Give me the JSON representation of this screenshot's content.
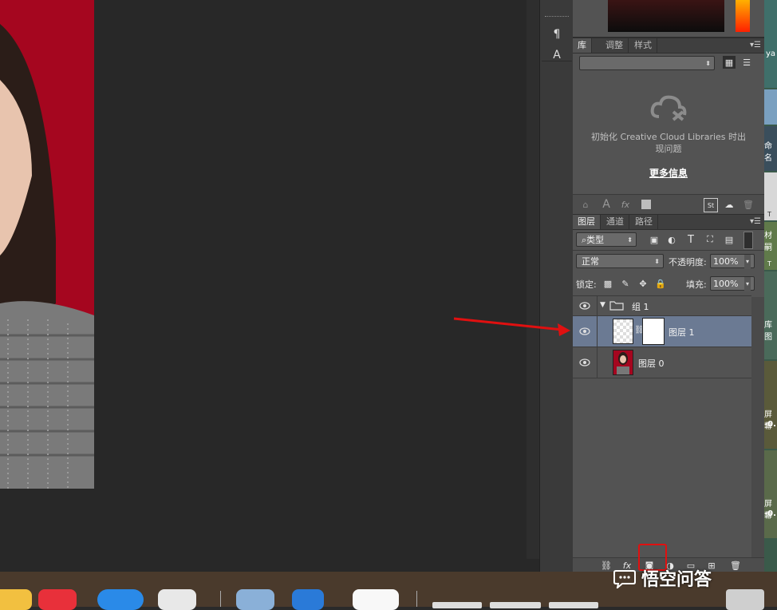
{
  "tool_strip": {
    "para_icon": "¶",
    "char_icon": "A"
  },
  "libraries": {
    "tabs": [
      "库",
      "调整",
      "样式"
    ],
    "error_message": "初始化 Creative Cloud Libraries 时出现问题",
    "more_info_link": "更多信息",
    "footer_icons": [
      "add-graphic-icon",
      "text-icon",
      "fx-icon",
      "color-swatch-icon",
      "stock-icon",
      "cloud-sync-icon",
      "trash-icon"
    ]
  },
  "layers": {
    "tabs": [
      "图层",
      "通道",
      "路径"
    ],
    "filter_kind": "类型",
    "blend_mode": "正常",
    "opacity_label": "不透明度:",
    "opacity_value": "100%",
    "lock_label": "锁定:",
    "fill_label": "填充:",
    "fill_value": "100%",
    "items": [
      {
        "name": "组 1",
        "type": "group"
      },
      {
        "name": "图层 1",
        "type": "layer-with-mask",
        "selected": true
      },
      {
        "name": "图层 0",
        "type": "photo"
      }
    ],
    "bottom_icons": [
      "link-icon",
      "fx-icon",
      "mask-icon",
      "adjustment-icon",
      "folder-icon",
      "new-layer-icon",
      "trash-icon"
    ]
  },
  "desktop_strip": [
    "ya",
    "命名",
    "T",
    "材嗣",
    "T",
    "库图",
    "屏幕",
    "-0.",
    "屏幕",
    "-0."
  ],
  "watermark": "悟空问答",
  "colors": {
    "accent_red": "#e01010",
    "selected_row": "#6b7a93",
    "canvas_red": "#a5061f"
  }
}
